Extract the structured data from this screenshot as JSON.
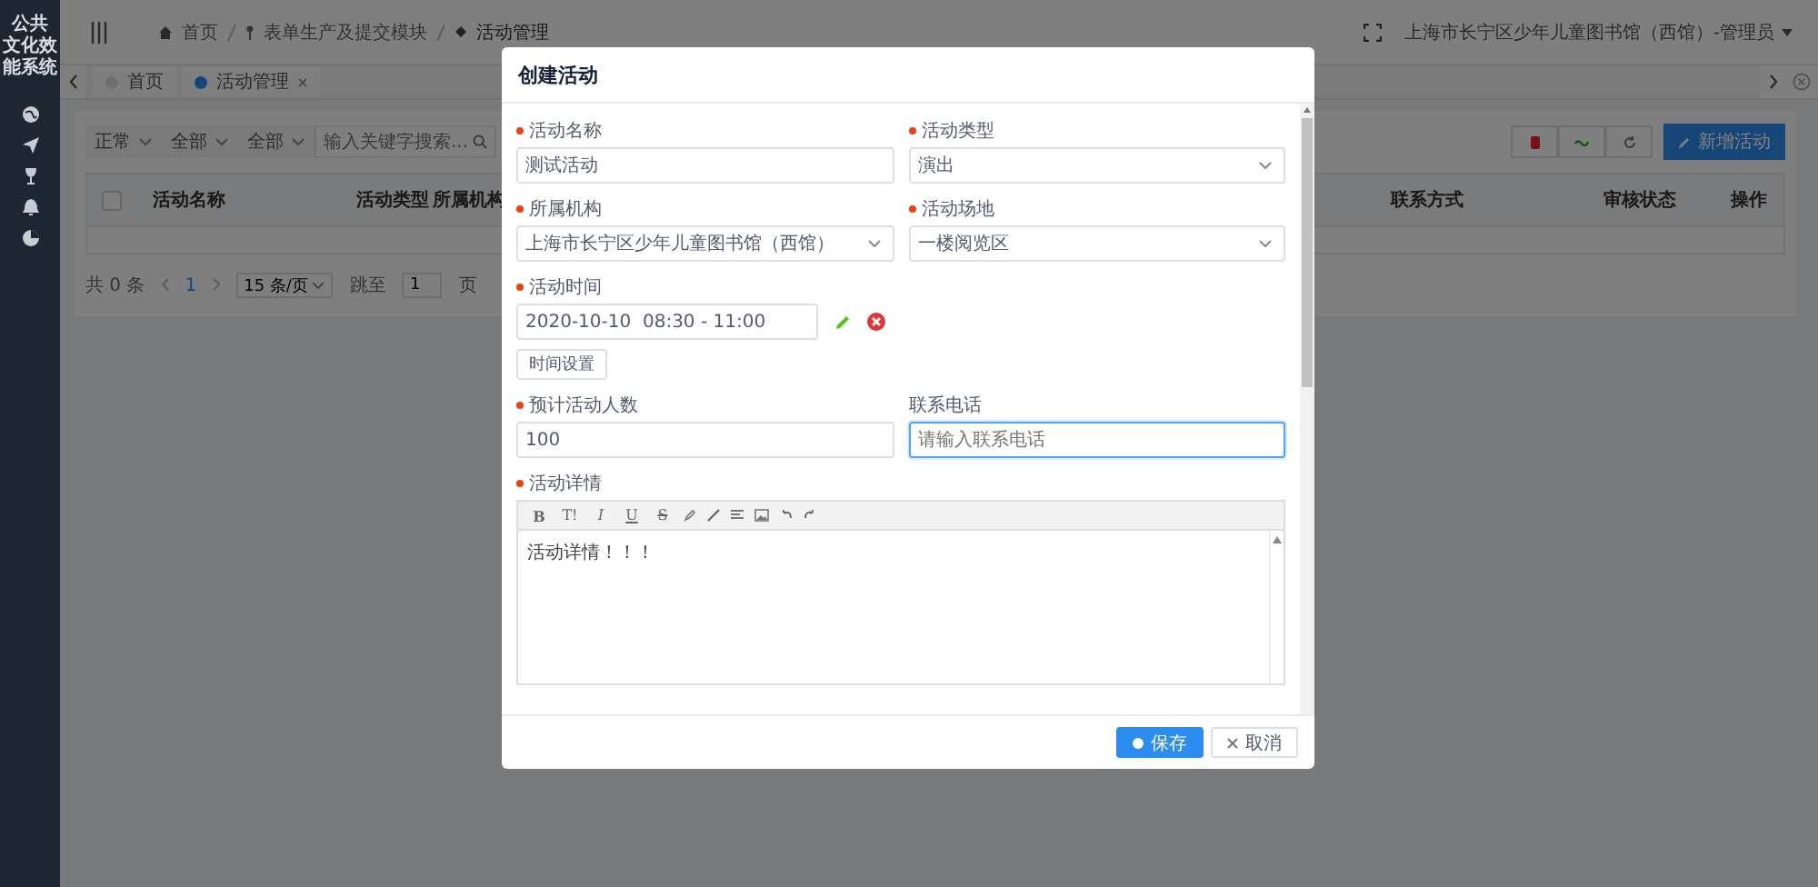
{
  "sidebar": {
    "title_lines": [
      "公共",
      "文化效",
      "能系统"
    ]
  },
  "header": {
    "breadcrumb": [
      "首页",
      "表单生产及提交模块",
      "活动管理"
    ],
    "user": "上海市长宁区少年儿童图书馆（西馆）-管理员"
  },
  "tabs": [
    {
      "label": "首页",
      "selected": false
    },
    {
      "label": "活动管理",
      "selected": true
    }
  ],
  "filters": {
    "selects": [
      "正常",
      "全部",
      "全部"
    ],
    "search_placeholder": "输入关键字搜索...",
    "add_button": "新增活动"
  },
  "table": {
    "select_all_checked": false,
    "columns": [
      "活动名称",
      "活动类型",
      "所属机构",
      "联系方式",
      "审核状态",
      "操作"
    ]
  },
  "pagination": {
    "total": "共 0 条",
    "page": "1",
    "page_size": "15 条/页",
    "jump_label": "跳至",
    "jump_value": "1",
    "page_suffix": "页"
  },
  "dialog": {
    "title": "创建活动",
    "fields": [
      {
        "kind": "input",
        "label": "活动名称",
        "required": true,
        "value": "测试活动",
        "focused": false
      },
      {
        "kind": "select",
        "label": "活动类型",
        "required": true,
        "value": "演出",
        "focused": false
      },
      {
        "kind": "select",
        "label": "所属机构",
        "required": true,
        "value": "上海市长宁区少年儿童图书馆（西馆）",
        "focused": false
      },
      {
        "kind": "select",
        "label": "活动场地",
        "required": true,
        "value": "一楼阅览区",
        "focused": false
      },
      {
        "kind": "time",
        "label": "活动时间",
        "required": true,
        "value": "2020-10-10  08:30 - 11:00",
        "button": "时间设置",
        "focused": false
      },
      {
        "kind": "input",
        "label": "预计活动人数",
        "required": true,
        "value": "100",
        "focused": false
      },
      {
        "kind": "input",
        "label": "联系电话",
        "required": false,
        "placeholder": "请输入联系电话",
        "focused": true
      },
      {
        "kind": "editor",
        "label": "活动详情",
        "required": true,
        "value": "活动详情！！！",
        "toolbar_labels": [
          "B",
          "T!",
          "I",
          "U",
          "S"
        ],
        "focused": false
      }
    ],
    "save": "保存",
    "cancel": "取消"
  }
}
